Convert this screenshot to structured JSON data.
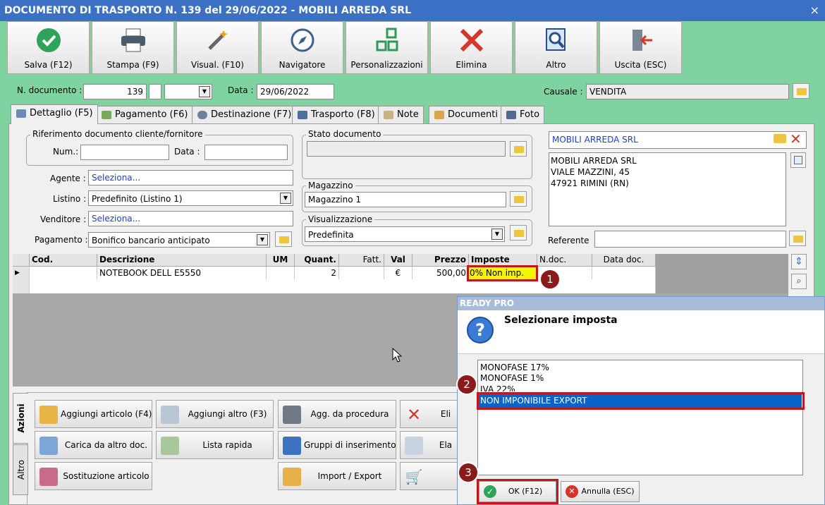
{
  "window": {
    "title": "DOCUMENTO DI TRASPORTO N. 139 del 29/06/2022 - MOBILI ARREDA SRL",
    "close": "×"
  },
  "toolbar": {
    "buttons": [
      {
        "label": "Salva (F12)",
        "icon": "check-circle-icon"
      },
      {
        "label": "Stampa (F9)",
        "icon": "printer-icon"
      },
      {
        "label": "Visual. (F10)",
        "icon": "magic-wand-icon"
      },
      {
        "label": "Navigatore",
        "icon": "compass-icon"
      },
      {
        "label": "Personalizzazioni",
        "icon": "blocks-icon"
      },
      {
        "label": "Elimina",
        "icon": "red-x-icon"
      },
      {
        "label": "Altro",
        "icon": "magnifier-doc-icon"
      },
      {
        "label": "Uscita (ESC)",
        "icon": "exit-door-icon"
      }
    ]
  },
  "header": {
    "doc_number_label": "N. documento :",
    "doc_number": "139",
    "date_label": "Data :",
    "date": "29/06/2022",
    "causale_label": "Causale :",
    "causale": "VENDITA"
  },
  "tabs": [
    "Dettaglio (F5)",
    "Pagamento (F6)",
    "Destinazione (F7)",
    "Trasporto (F8)",
    "Note",
    "Documenti",
    "Foto"
  ],
  "form": {
    "rif_title": "Riferimento documento cliente/fornitore",
    "num_label": "Num.:",
    "data_label": "Data :",
    "agente_label": "Agente :",
    "agente": "Seleziona...",
    "listino_label": "Listino :",
    "listino": "Predefinito (Listino 1)",
    "venditore_label": "Venditore :",
    "venditore": "Seleziona...",
    "pagamento_label": "Pagamento :",
    "pagamento": "Bonifico bancario anticipato",
    "stato_title": "Stato documento",
    "magazzino_title": "Magazzino",
    "magazzino": "Magazzino 1",
    "visual_title": "Visualizzazione",
    "visual": "Predefinita",
    "cliente": "MOBILI ARREDA SRL",
    "address": [
      "MOBILI ARREDA SRL",
      "VIALE MAZZINI, 45",
      "47921 RIMINI (RN)"
    ],
    "referente_label": "Referente"
  },
  "grid": {
    "columns": [
      "Cod.",
      "Descrizione",
      "UM",
      "Quant.",
      "Fatt.",
      "Val",
      "Prezzo",
      "Imposte",
      "N.doc.",
      "Data doc."
    ],
    "row": {
      "cod": "",
      "desc": "NOTEBOOK DELL E5550",
      "um": "",
      "quant": "2",
      "fatt": "",
      "val": "€",
      "prezzo": "500,00",
      "imposte": "0% Non imp.",
      "ndoc": "",
      "datadoc": ""
    }
  },
  "actions": {
    "side_tabs": [
      "Azioni",
      "Altro"
    ],
    "buttons": [
      [
        "Aggiungi articolo (F4)",
        "Aggiungi altro (F3)",
        "Agg. da procedura",
        "Eli"
      ],
      [
        "Carica da altro doc.",
        "Lista rapida",
        "Gruppi di inserimento",
        "Ela"
      ],
      [
        "Sostituzione articolo",
        "",
        "Import / Export",
        ""
      ]
    ]
  },
  "dialog": {
    "title": "READY PRO",
    "message": "Selezionare imposta",
    "options": [
      "MONOFASE 17%",
      "MONOFASE 1%",
      "IVA 22%",
      "NON IMPONIBILE EXPORT"
    ],
    "selected_index": 3,
    "ok": "OK (F12)",
    "cancel": "Annulla (ESC)"
  },
  "badges": [
    "1",
    "2",
    "3"
  ],
  "colors": {
    "title_bar": "#3b70c4",
    "frame": "#7fd3a1",
    "highlight": "#0a64c8",
    "annotation": "#c0181b",
    "cell_yellow": "#f5f500"
  }
}
